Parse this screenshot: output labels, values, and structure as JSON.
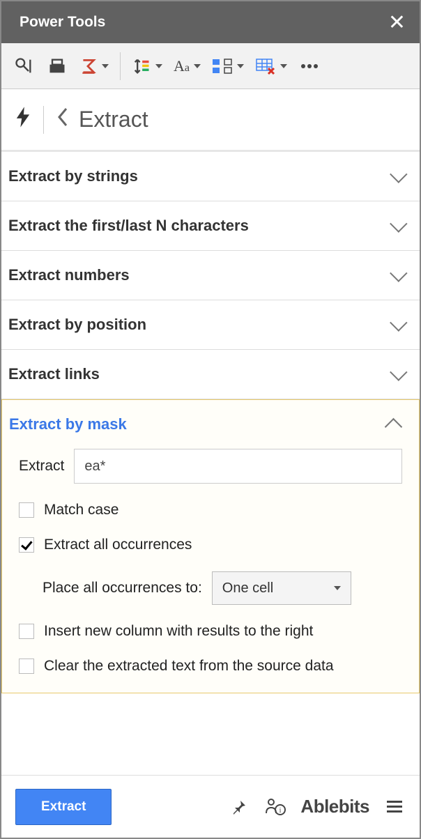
{
  "window": {
    "title": "Power Tools"
  },
  "breadcrumb": {
    "title": "Extract"
  },
  "sections": {
    "by_strings": "Extract by strings",
    "first_last": "Extract the first/last N characters",
    "numbers": "Extract numbers",
    "by_position": "Extract by position",
    "links": "Extract links",
    "by_mask": "Extract by mask"
  },
  "mask": {
    "extract_label": "Extract",
    "pattern_value": "ea*",
    "match_case_label": "Match case",
    "match_case_checked": false,
    "all_occurrences_label": "Extract all occurrences",
    "all_occurrences_checked": true,
    "place_label": "Place all occurrences to:",
    "place_value": "One cell",
    "insert_column_label": "Insert new column with results to the right",
    "insert_column_checked": false,
    "clear_source_label": "Clear the extracted text from the source data",
    "clear_source_checked": false
  },
  "footer": {
    "button": "Extract",
    "brand": "Ablebits"
  }
}
